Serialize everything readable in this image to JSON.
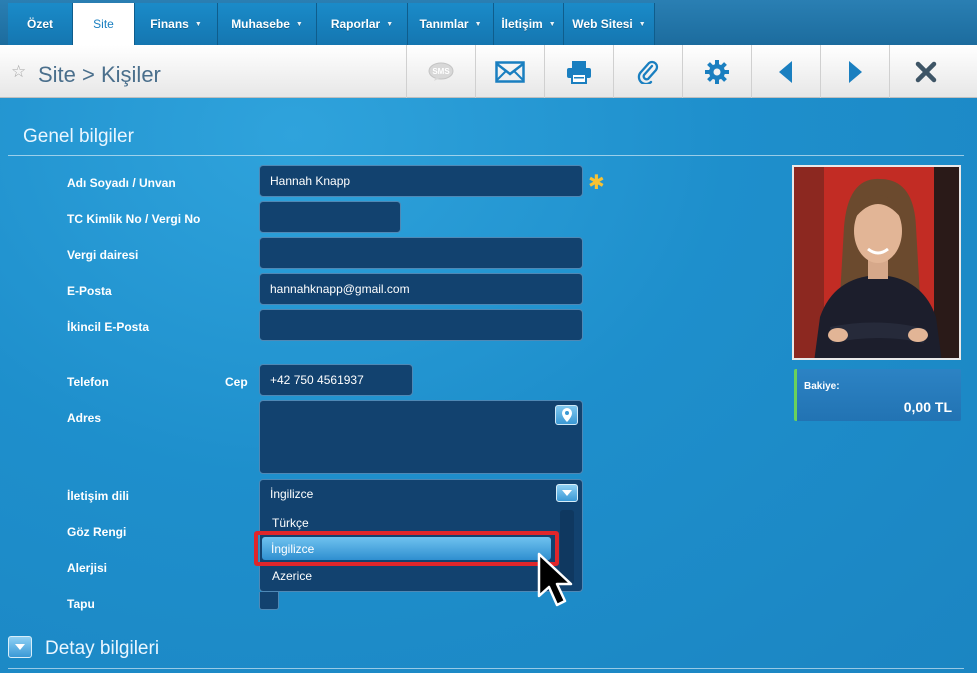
{
  "nav": {
    "tabs": [
      {
        "label": "Özet",
        "caret": false,
        "active": false
      },
      {
        "label": "Site",
        "caret": false,
        "active": true
      },
      {
        "label": "Finans",
        "caret": true,
        "active": false
      },
      {
        "label": "Muhasebe",
        "caret": true,
        "active": false
      },
      {
        "label": "Raporlar",
        "caret": true,
        "active": false
      },
      {
        "label": "Tanımlar",
        "caret": true,
        "active": false
      },
      {
        "label": "İletişim",
        "caret": true,
        "active": false
      },
      {
        "label": "Web Sitesi",
        "caret": true,
        "active": false
      }
    ]
  },
  "header": {
    "title": "Site > Kişiler",
    "toolbar": [
      "sms-icon",
      "mail-icon",
      "print-icon",
      "attach-icon",
      "gear-icon",
      "prev-icon",
      "next-icon",
      "close-icon"
    ]
  },
  "sections": {
    "general": "Genel bilgiler",
    "detail": "Detay bilgileri"
  },
  "form": {
    "name_label": "Adı Soyadı / Unvan",
    "name_value": "Hannah Knapp",
    "tc_label": "TC Kimlik No / Vergi No",
    "tc_value": "",
    "tax_office_label": "Vergi dairesi",
    "tax_office_value": "",
    "email_label": "E-Posta",
    "email_value": "hannahknapp@gmail.com",
    "email2_label": "İkincil E-Posta",
    "email2_value": "",
    "phone_label": "Telefon",
    "phone_type": "Cep",
    "phone_value": "+42 750 4561937",
    "address_label": "Adres",
    "address_value": "",
    "lang_label": "İletişim dili",
    "lang_value": "İngilizce",
    "eye_label": "Göz Rengi",
    "allergy_label": "Alerjisi",
    "deed_label": "Tapu"
  },
  "dropdown": {
    "options": [
      "Türkçe",
      "İngilizce",
      "Azerice"
    ],
    "selected": "İngilizce"
  },
  "balance": {
    "label": "Bakiye:",
    "value": "0,00 TL"
  },
  "colors": {
    "background": "#1e8fcc",
    "field_bg": "#12426f",
    "highlight": "#e0262b",
    "required": "#f7c233",
    "balance_accent": "#6ad15c"
  }
}
